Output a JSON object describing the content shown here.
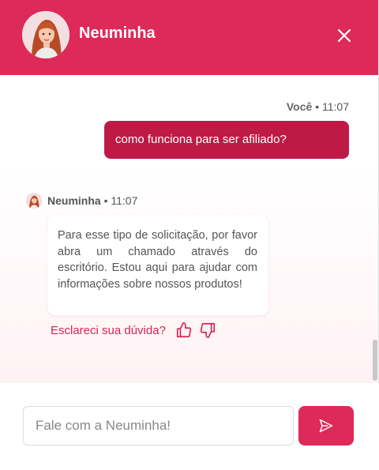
{
  "header": {
    "name": "Neuminha",
    "avatar_icon": "woman-avatar-icon",
    "close_icon": "close-icon",
    "background_color": "#dd2a58"
  },
  "messages": {
    "user": {
      "sender": "Você",
      "separator": "•",
      "time": "11:07",
      "text": "como funciona para ser afiliado?",
      "bubble_color": "#bd1b46"
    },
    "bot": {
      "sender": "Neuminha",
      "separator": "•",
      "time": "11:07",
      "text": "Para esse tipo de solicitação, por favor abra um chamado através do escritório. Estou aqui para ajudar com informações sobre nossos produtos!",
      "feedback_prompt": "Esclareci sua dúvida?",
      "thumbs_up_icon": "thumbs-up-icon",
      "thumbs_down_icon": "thumbs-down-icon"
    }
  },
  "composer": {
    "placeholder": "Fale com a Neuminha!",
    "value": "",
    "send_icon": "send-icon",
    "accent_color": "#dd2a58"
  }
}
